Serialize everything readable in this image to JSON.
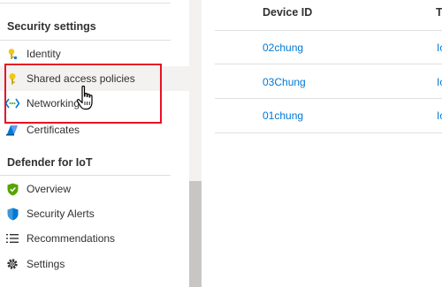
{
  "sidebar": {
    "security_header": "Security settings",
    "security_items": [
      {
        "label": "Identity",
        "icon": "key-icon"
      },
      {
        "label": "Shared access policies",
        "icon": "key-icon",
        "selected": true
      },
      {
        "label": "Networking",
        "icon": "networking-icon"
      },
      {
        "label": "Certificates",
        "icon": "certificate-icon"
      }
    ],
    "defender_header": "Defender for IoT",
    "defender_items": [
      {
        "label": "Overview",
        "icon": "shield-icon"
      },
      {
        "label": "Security Alerts",
        "icon": "shield-alert-icon"
      },
      {
        "label": "Recommendations",
        "icon": "list-icon"
      },
      {
        "label": "Settings",
        "icon": "gear-icon"
      }
    ]
  },
  "table": {
    "columns": [
      "Device ID",
      "T"
    ],
    "rows": [
      {
        "device_id": "02chung",
        "type": "Io"
      },
      {
        "device_id": "03Chung",
        "type": "Io"
      },
      {
        "device_id": "01chung",
        "type": "Io"
      }
    ]
  },
  "colors": {
    "accent": "#0078d4",
    "highlight": "#e81123",
    "selected_bg": "#f3f2f1",
    "key_icon": "#f2c811"
  }
}
